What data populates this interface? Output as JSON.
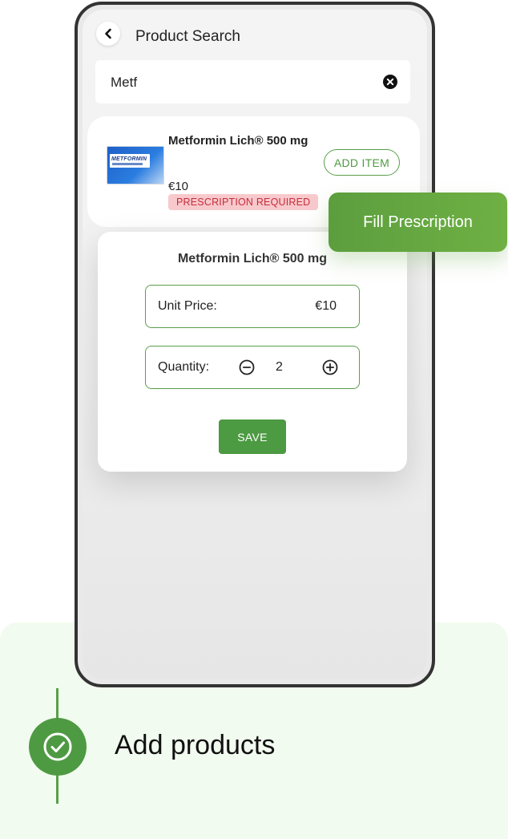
{
  "header": {
    "title": "Product Search"
  },
  "search": {
    "value": "Metf"
  },
  "result": {
    "name": "Metformin Lich® 500 mg",
    "price": "€10",
    "badge": "PRESCRIPTION REQUIRED",
    "add_label": "ADD ITEM",
    "pack_text": "METFORMIN"
  },
  "modal": {
    "title": "Metformin Lich® 500 mg",
    "unit_price_label": "Unit Price:",
    "unit_price_value": "€10",
    "quantity_label": "Quantity:",
    "quantity_value": "2",
    "save_label": "SAVE"
  },
  "callout": {
    "label": "Fill Prescription"
  },
  "step": {
    "label": "Add products"
  },
  "colors": {
    "accent": "#4e9a42",
    "badge_bg": "#f8c9cc",
    "badge_text": "#c62d3b",
    "panel_bg": "#f2fbef"
  },
  "icons": [
    "back-arrow-icon",
    "clear-search-icon",
    "minus-circle-icon",
    "plus-circle-icon",
    "check-icon"
  ]
}
